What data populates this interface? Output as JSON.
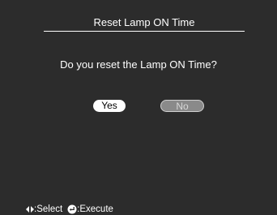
{
  "dialog": {
    "title": "Reset Lamp ON Time",
    "question": "Do you reset the Lamp ON Time?",
    "yes_label": "Yes",
    "no_label": "No"
  },
  "footer": {
    "select_icon": "left-right-arrows-icon",
    "select_label": ":Select",
    "execute_icon": "enter-icon",
    "execute_label": ":Execute"
  },
  "colors": {
    "background": "#2c2c2c",
    "text": "#ffffff",
    "yes_button": "#ffffff",
    "no_button": "#8a8a8a"
  }
}
